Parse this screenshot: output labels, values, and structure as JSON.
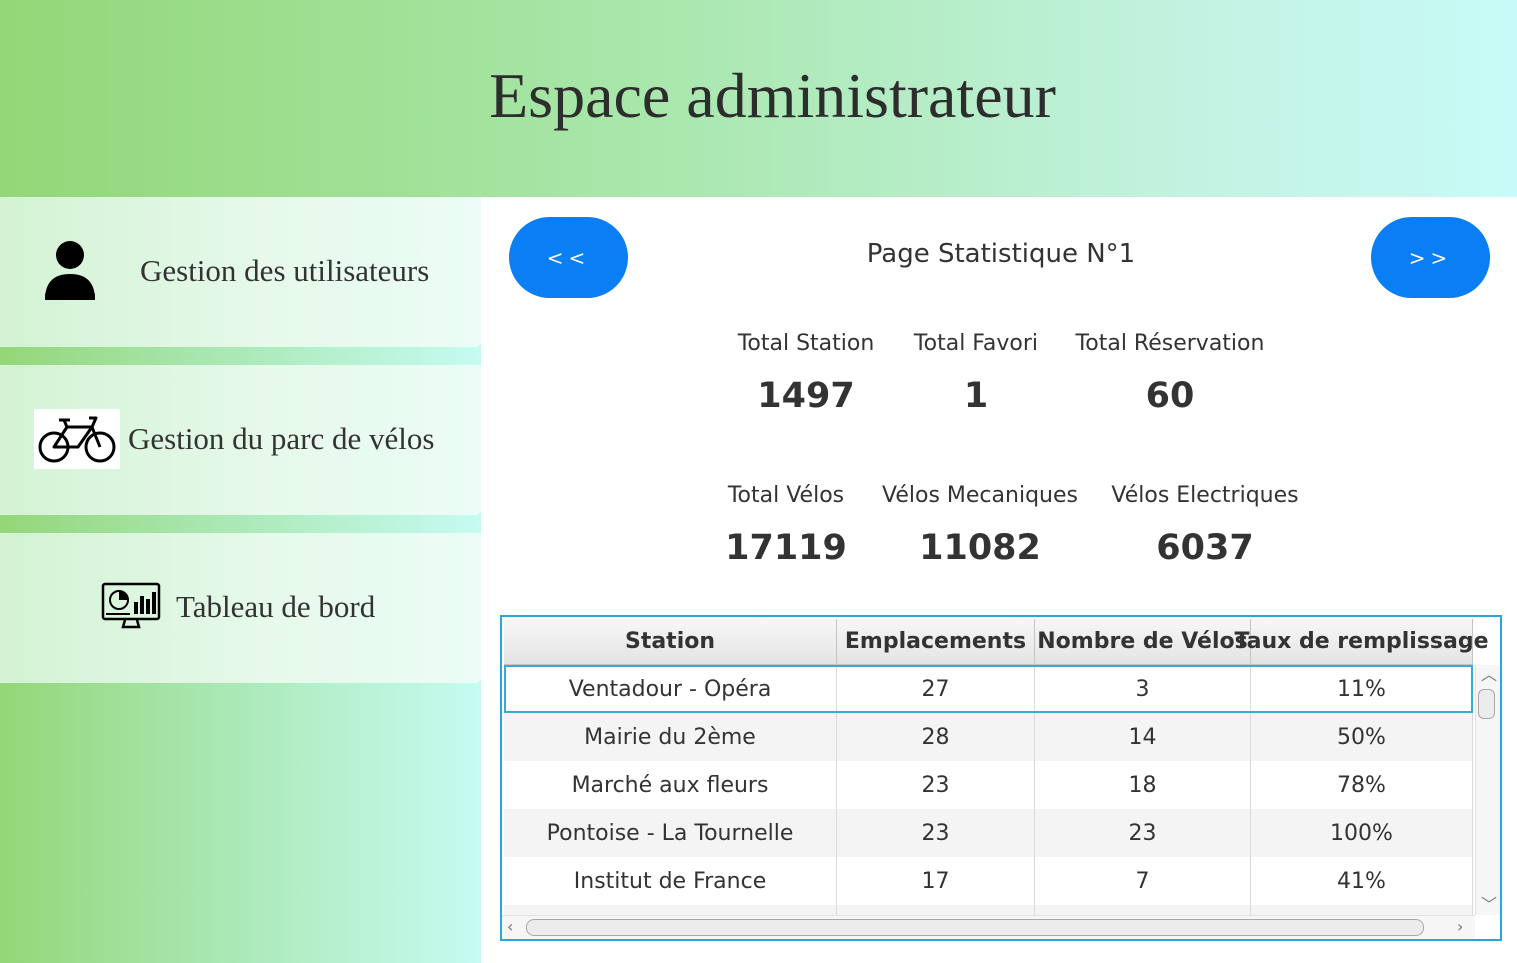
{
  "header": {
    "title": "Espace administrateur"
  },
  "sidebar": {
    "items": [
      {
        "label": "Gestion des utilisateurs",
        "icon": "user-icon"
      },
      {
        "label": "Gestion du parc de vélos",
        "icon": "bicycle-icon"
      },
      {
        "label": "Tableau de bord",
        "icon": "dashboard-monitor-icon"
      }
    ]
  },
  "pager": {
    "prev_label": "<<",
    "next_label": ">>",
    "title": "Page Statistique N°1"
  },
  "stats": [
    {
      "label": "Total Station",
      "value": "1497"
    },
    {
      "label": "Total Favori",
      "value": "1"
    },
    {
      "label": "Total Réservation",
      "value": "60"
    },
    {
      "label": "Total Vélos",
      "value": "17119"
    },
    {
      "label": "Vélos Mecaniques",
      "value": "11082"
    },
    {
      "label": "Vélos Electriques",
      "value": "6037"
    }
  ],
  "table": {
    "columns": [
      "Station",
      "Emplacements",
      "Nombre de Vélos",
      "Taux de remplissage"
    ],
    "rows": [
      [
        "Ventadour - Opéra",
        "27",
        "3",
        "11%"
      ],
      [
        "Mairie du 2ème",
        "28",
        "14",
        "50%"
      ],
      [
        "Marché aux fleurs",
        "23",
        "18",
        "78%"
      ],
      [
        "Pontoise - La Tournelle",
        "23",
        "23",
        "100%"
      ],
      [
        "Institut de France",
        "17",
        "7",
        "41%"
      ]
    ]
  },
  "colors": {
    "accent_button": "#0a7ef5",
    "table_border": "#2aa6de",
    "header_gradient_start": "#93d778",
    "header_gradient_end": "#c8fbf8"
  }
}
